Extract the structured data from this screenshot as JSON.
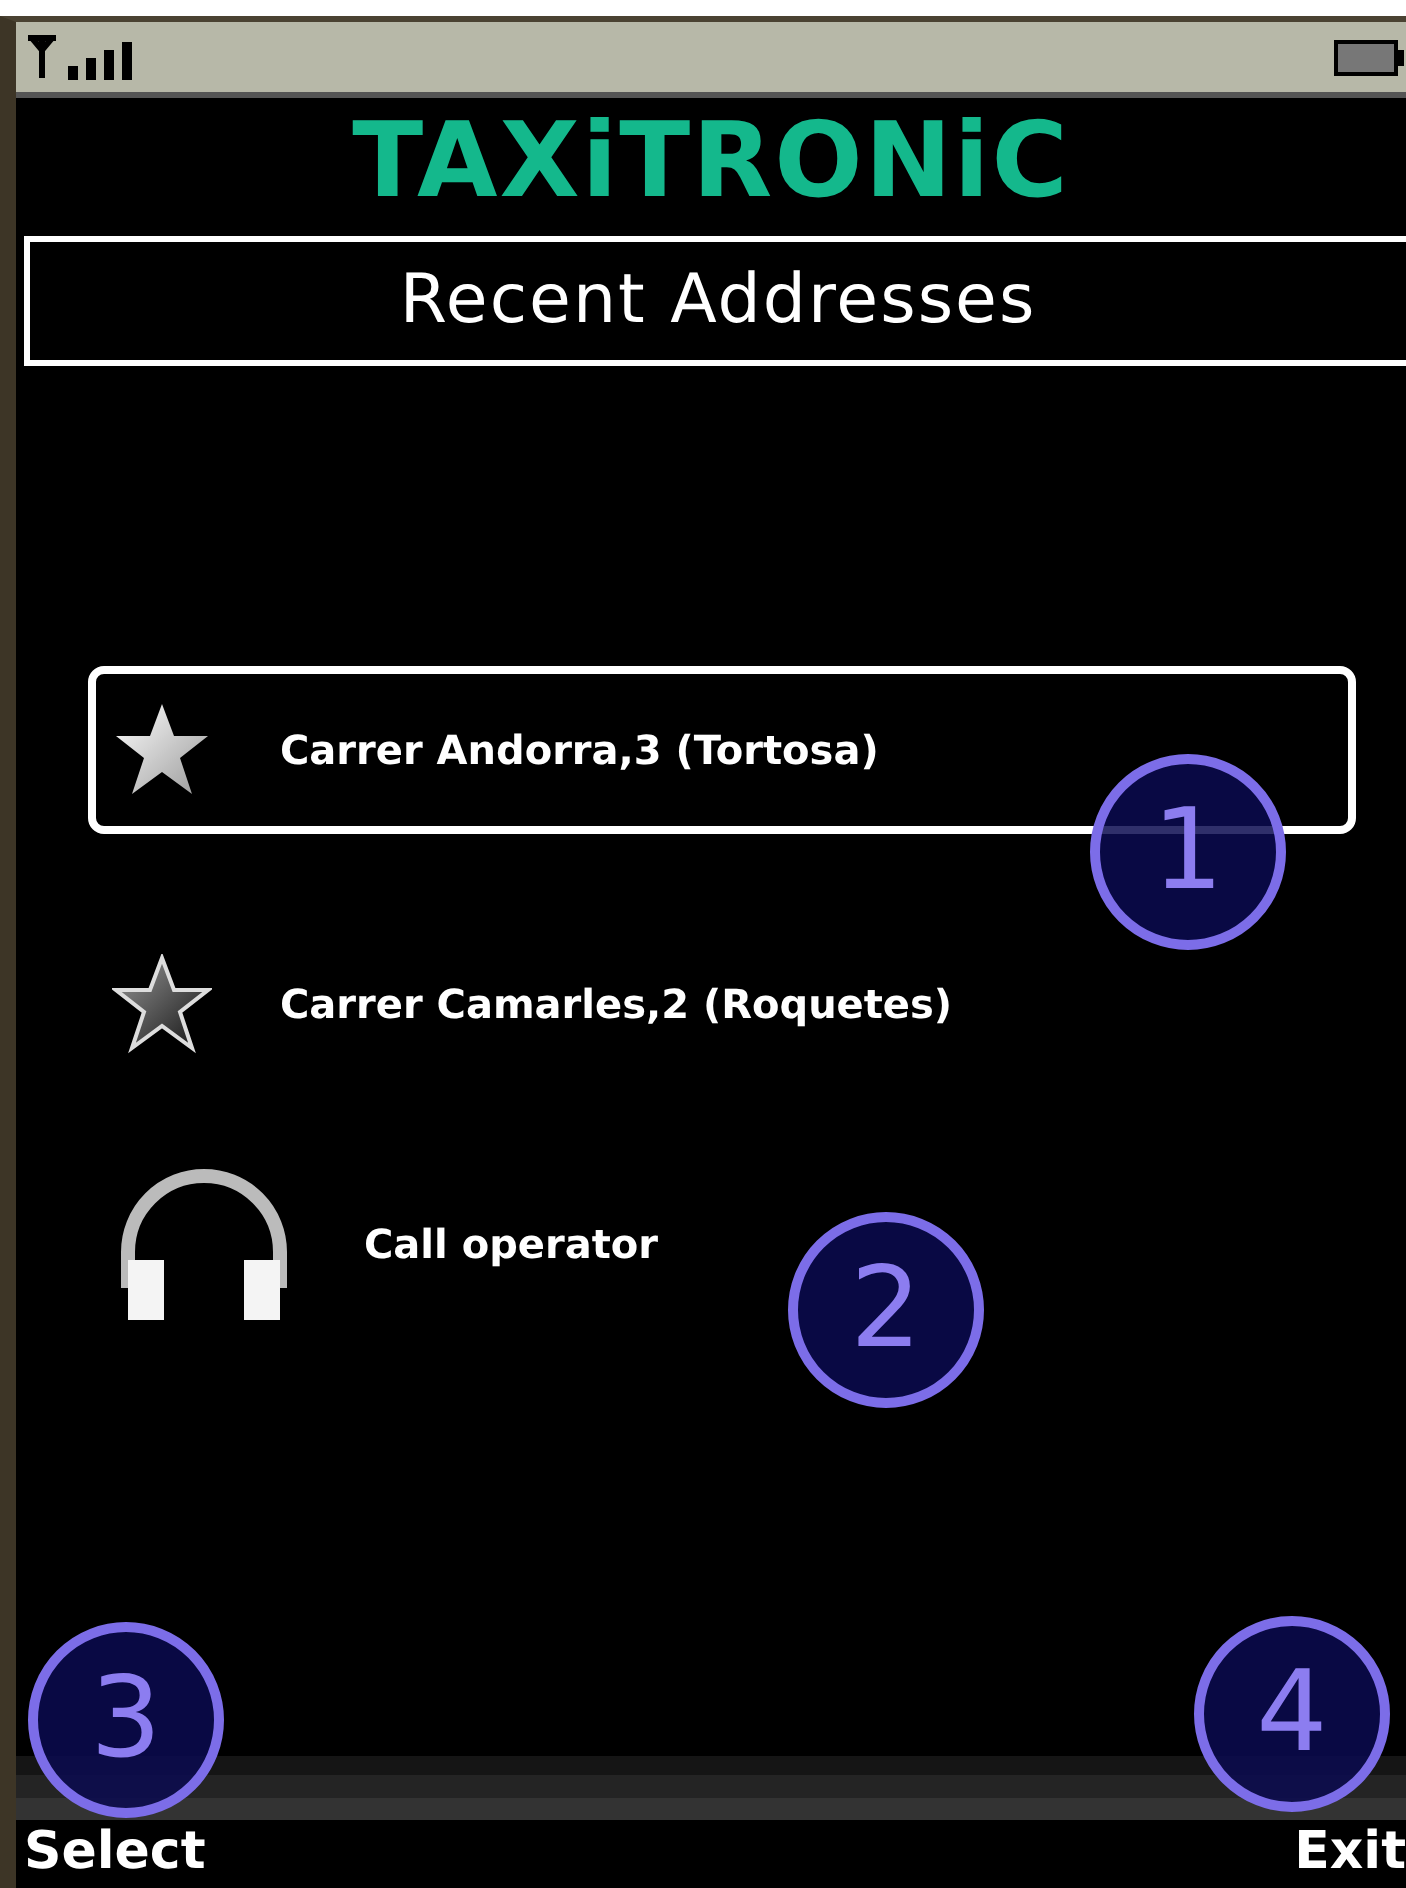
{
  "app": {
    "logo": "TAXiTRONiC",
    "title": "Recent Addresses"
  },
  "items": [
    {
      "label": "Carrer Andorra,3 (Tortosa)",
      "kind": "star",
      "selected": true
    },
    {
      "label": "Carrer Camarles,2 (Roquetes)",
      "kind": "star",
      "selected": false
    },
    {
      "label": "Call operator",
      "kind": "headset",
      "selected": false
    }
  ],
  "softkeys": {
    "left": "Select",
    "right": "Exit"
  },
  "callouts": [
    {
      "number": "1"
    },
    {
      "number": "2"
    },
    {
      "number": "3"
    },
    {
      "number": "4"
    }
  ]
}
